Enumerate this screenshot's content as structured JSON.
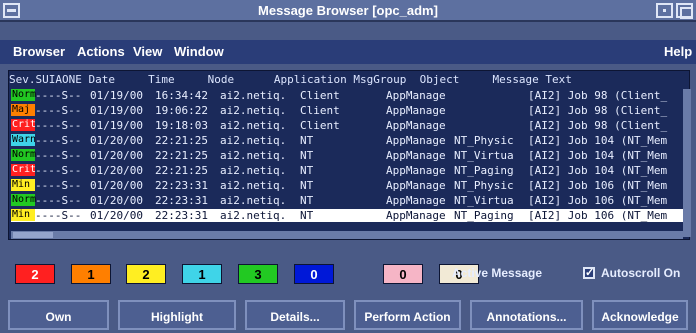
{
  "window": {
    "title": "Message Browser [opc_adm]"
  },
  "menubar": {
    "items": [
      "Browser",
      "Actions",
      "View",
      "Window"
    ],
    "help": "Help"
  },
  "list": {
    "header": "Sev.SUIAONE Date     Time     Node      Application MsgGroup  Object     Message Text",
    "rows": [
      {
        "sev": "Norm",
        "sev_color": "#22c922",
        "flags": "----S--",
        "date": "01/19/00",
        "time": "16:34:42",
        "node": "ai2.netiq.",
        "application": "Client",
        "msggroup": "AppManage",
        "object": "",
        "text": "[AI2] Job 98 (Client_"
      },
      {
        "sev": "Maj",
        "sev_color": "#ff7f00",
        "flags": "----S--",
        "date": "01/19/00",
        "time": "19:06:22",
        "node": "ai2.netiq.",
        "application": "Client",
        "msggroup": "AppManage",
        "object": "",
        "text": "[AI2] Job 98 (Client_"
      },
      {
        "sev": "Crit",
        "sev_color": "#ff2020",
        "flags": "----S--",
        "date": "01/19/00",
        "time": "19:18:03",
        "node": "ai2.netiq.",
        "application": "Client",
        "msggroup": "AppManage",
        "object": "",
        "text": "[AI2] Job 98 (Client_"
      },
      {
        "sev": "Warn",
        "sev_color": "#3fd4e8",
        "flags": "----S--",
        "date": "01/20/00",
        "time": "22:21:25",
        "node": "ai2.netiq.",
        "application": "NT",
        "msggroup": "AppManage",
        "object": "NT_Physic",
        "text": "[AI2] Job 104 (NT_Mem"
      },
      {
        "sev": "Norm",
        "sev_color": "#22c922",
        "flags": "----S--",
        "date": "01/20/00",
        "time": "22:21:25",
        "node": "ai2.netiq.",
        "application": "NT",
        "msggroup": "AppManage",
        "object": "NT_Virtua",
        "text": "[AI2] Job 104 (NT_Mem"
      },
      {
        "sev": "Crit",
        "sev_color": "#ff2020",
        "flags": "----S--",
        "date": "01/20/00",
        "time": "22:21:25",
        "node": "ai2.netiq.",
        "application": "NT",
        "msggroup": "AppManage",
        "object": "NT_Paging",
        "text": "[AI2] Job 104 (NT_Mem"
      },
      {
        "sev": "Min",
        "sev_color": "#ffee22",
        "flags": "----S--",
        "date": "01/20/00",
        "time": "22:23:31",
        "node": "ai2.netiq.",
        "application": "NT",
        "msggroup": "AppManage",
        "object": "NT_Physic",
        "text": "[AI2] Job 106 (NT_Mem"
      },
      {
        "sev": "Norm",
        "sev_color": "#22c922",
        "flags": "----S--",
        "date": "01/20/00",
        "time": "22:23:31",
        "node": "ai2.netiq.",
        "application": "NT",
        "msggroup": "AppManage",
        "object": "NT_Virtua",
        "text": "[AI2] Job 106 (NT_Mem"
      },
      {
        "sev": "Min",
        "sev_color": "#ffee22",
        "flags": "----S--",
        "date": "01/20/00",
        "time": "22:23:31",
        "node": "ai2.netiq.",
        "application": "NT",
        "msggroup": "AppManage",
        "object": "NT_Paging",
        "text": "[AI2] Job 106 (NT_Mem",
        "selected": true
      }
    ]
  },
  "counts": [
    {
      "value": "2",
      "bg": "#ff2020",
      "fg": "#ffffff"
    },
    {
      "value": "1",
      "bg": "#ff7f00",
      "fg": "#000000"
    },
    {
      "value": "2",
      "bg": "#ffee22",
      "fg": "#000000"
    },
    {
      "value": "1",
      "bg": "#3fd4e8",
      "fg": "#000000"
    },
    {
      "value": "3",
      "bg": "#22c922",
      "fg": "#000000"
    },
    {
      "value": "0",
      "bg": "#0018d8",
      "fg": "#ffffff"
    },
    {
      "value": "0",
      "bg": "#f6b5c6",
      "fg": "#000000"
    },
    {
      "value": "0",
      "bg": "#f2ead6",
      "fg": "#000000"
    }
  ],
  "status": {
    "active_message": "Active Message",
    "autoscroll_label": "Autoscroll On",
    "autoscroll_checked": "✓"
  },
  "buttons": [
    "Own",
    "Highlight",
    "Details...",
    "Perform Action",
    "Annotations...",
    "Acknowledge"
  ],
  "colors": {
    "window_bg": "#4a5a86",
    "list_bg": "#1b2a5a",
    "menubar_bg": "#2a3d78",
    "selected_row_bg": "#ffffff"
  }
}
